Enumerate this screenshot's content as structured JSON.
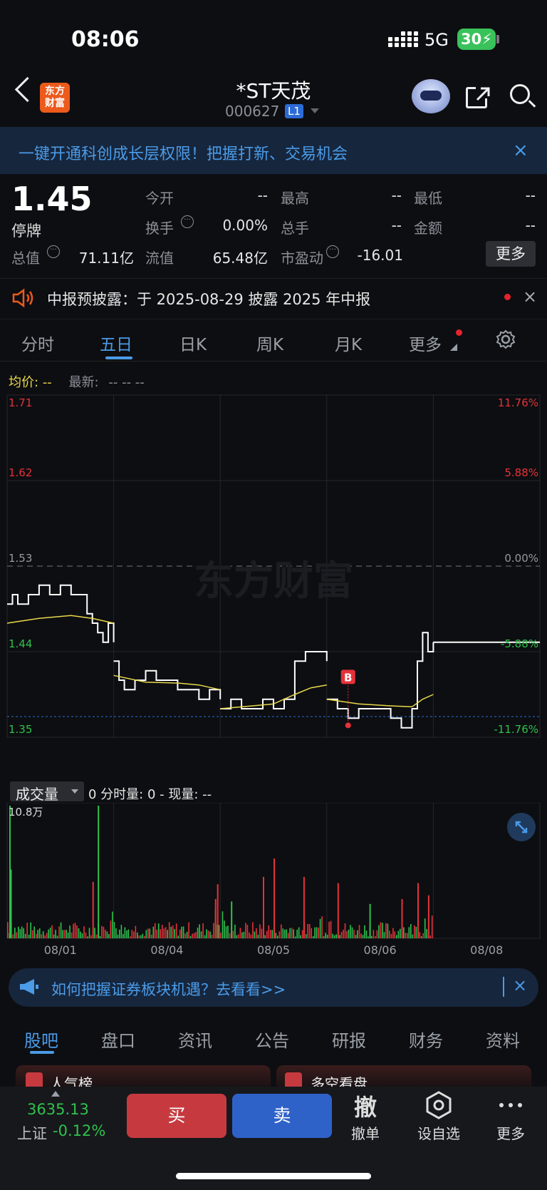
{
  "status_bar": {
    "time": "08:06",
    "network": "5G",
    "battery": "30"
  },
  "header": {
    "logo_text_1": "东方",
    "logo_text_2": "财富",
    "name": "*ST天茂",
    "code": "000627",
    "level": "L1"
  },
  "banner": {
    "text": "一键开通科创成长层权限！把握打新、交易机会",
    "close": "×"
  },
  "quote": {
    "price": "1.45",
    "status": "停牌",
    "rows": [
      [
        {
          "label": "今开",
          "value": "--"
        },
        {
          "label": "最高",
          "value": "--"
        },
        {
          "label": "最低",
          "value": "--"
        }
      ],
      [
        {
          "label": "换手",
          "value": "0.00%"
        },
        {
          "label": "总手",
          "value": "--"
        },
        {
          "label": "金额",
          "value": "--"
        }
      ],
      [
        {
          "label": "总值",
          "value": "71.11亿"
        },
        {
          "label": "流值",
          "value": "65.48亿"
        },
        {
          "label": "市盈动",
          "value": "-16.01"
        }
      ]
    ],
    "more": "更多"
  },
  "notice": {
    "text": "中报预披露：于 2025-08-29 披露 2025 年中报",
    "close": "×"
  },
  "chart_tabs": {
    "items": [
      "分时",
      "五日",
      "日K",
      "周K",
      "月K",
      "更多"
    ],
    "active_index": 1
  },
  "legend": {
    "avg_label": "均价:",
    "avg_value": "--",
    "latest_label": "最新:",
    "latest_values": "--  --  --"
  },
  "watermark": "东方财富",
  "colors": {
    "up": "#e5323a",
    "down": "#2ec24d",
    "price_line": "#ffffff",
    "avg_line": "#e8d84a",
    "accent": "#4b9be8"
  },
  "chart_data": {
    "type": "line",
    "x_labels": [
      "08/01",
      "08/04",
      "08/05",
      "08/06",
      "08/08"
    ],
    "y_ticks_left": [
      "1.71",
      "1.62",
      "1.53",
      "1.44",
      "1.35"
    ],
    "y_ticks_right": [
      "11.76%",
      "5.88%",
      "0.00%",
      "-5.88%",
      "-11.76%"
    ],
    "ylim": [
      1.35,
      1.71
    ],
    "prev_close": 1.53,
    "series": [
      {
        "name": "price",
        "days": [
          [
            [
              0,
              1.49
            ],
            [
              0.05,
              1.5
            ],
            [
              0.1,
              1.49
            ],
            [
              0.2,
              1.5
            ],
            [
              0.3,
              1.51
            ],
            [
              0.4,
              1.5
            ],
            [
              0.5,
              1.51
            ],
            [
              0.6,
              1.5
            ],
            [
              0.7,
              1.5
            ],
            [
              0.75,
              1.48
            ],
            [
              0.8,
              1.47
            ],
            [
              0.85,
              1.46
            ],
            [
              0.9,
              1.45
            ],
            [
              0.95,
              1.47
            ],
            [
              1,
              1.45
            ]
          ],
          [
            [
              0,
              1.43
            ],
            [
              0.05,
              1.41
            ],
            [
              0.1,
              1.4
            ],
            [
              0.2,
              1.41
            ],
            [
              0.3,
              1.42
            ],
            [
              0.4,
              1.41
            ],
            [
              0.5,
              1.41
            ],
            [
              0.6,
              1.4
            ],
            [
              0.7,
              1.4
            ],
            [
              0.8,
              1.39
            ],
            [
              0.9,
              1.4
            ],
            [
              1,
              1.39
            ]
          ],
          [
            [
              0,
              1.38
            ],
            [
              0.1,
              1.39
            ],
            [
              0.2,
              1.38
            ],
            [
              0.3,
              1.38
            ],
            [
              0.4,
              1.39
            ],
            [
              0.5,
              1.38
            ],
            [
              0.6,
              1.39
            ],
            [
              0.7,
              1.43
            ],
            [
              0.8,
              1.44
            ],
            [
              0.9,
              1.44
            ],
            [
              1,
              1.43
            ]
          ],
          [
            [
              0,
              1.39
            ],
            [
              0.1,
              1.38
            ],
            [
              0.2,
              1.37
            ],
            [
              0.3,
              1.38
            ],
            [
              0.4,
              1.38
            ],
            [
              0.5,
              1.38
            ],
            [
              0.6,
              1.37
            ],
            [
              0.7,
              1.36
            ],
            [
              0.8,
              1.38
            ],
            [
              0.85,
              1.43
            ],
            [
              0.9,
              1.46
            ],
            [
              0.95,
              1.44
            ],
            [
              1,
              1.45
            ]
          ],
          [
            [
              0,
              1.45
            ],
            [
              1,
              1.45
            ]
          ]
        ]
      },
      {
        "name": "average",
        "days": [
          [
            [
              0,
              1.47
            ],
            [
              0.3,
              1.475
            ],
            [
              0.6,
              1.478
            ],
            [
              0.8,
              1.475
            ],
            [
              1,
              1.47
            ]
          ],
          [
            [
              0,
              1.415
            ],
            [
              0.3,
              1.408
            ],
            [
              0.6,
              1.407
            ],
            [
              0.8,
              1.405
            ],
            [
              1,
              1.4
            ]
          ],
          [
            [
              0,
              1.38
            ],
            [
              0.3,
              1.383
            ],
            [
              0.5,
              1.385
            ],
            [
              0.7,
              1.395
            ],
            [
              0.85,
              1.402
            ],
            [
              1,
              1.405
            ]
          ],
          [
            [
              0,
              1.39
            ],
            [
              0.3,
              1.385
            ],
            [
              0.6,
              1.383
            ],
            [
              0.8,
              1.382
            ],
            [
              0.9,
              1.39
            ],
            [
              1,
              1.395
            ]
          ],
          []
        ]
      }
    ],
    "marker": {
      "label": "B",
      "day": 3,
      "t": 0.2,
      "price": 1.355
    },
    "volume": {
      "max_label": "10.8万",
      "max": 108000,
      "spikes": [
        [
          0,
          0.02,
          108000,
          "down"
        ],
        [
          0,
          0.03,
          56000,
          "down"
        ],
        [
          0,
          0.85,
          108000,
          "down"
        ],
        [
          0,
          0.8,
          46000,
          "up"
        ],
        [
          1,
          0.95,
          32000,
          "up"
        ],
        [
          1,
          0.97,
          44000,
          "up"
        ],
        [
          2,
          0.4,
          50000,
          "up"
        ],
        [
          2,
          0.5,
          65000,
          "up"
        ],
        [
          2,
          0.1,
          30000,
          "down"
        ],
        [
          2,
          0.78,
          50000,
          "up"
        ],
        [
          3,
          0.1,
          45000,
          "up"
        ],
        [
          3,
          0.4,
          28000,
          "down"
        ],
        [
          3,
          0.7,
          32000,
          "up"
        ],
        [
          3,
          0.85,
          45000,
          "up"
        ],
        [
          3,
          0.95,
          35000,
          "up"
        ]
      ]
    }
  },
  "volume_header": {
    "selector": "成交量",
    "info": "0  分时量: 0  -  现量: --"
  },
  "ad": {
    "text": "如何把握证券板块机遇？去看看>>",
    "close": "×"
  },
  "bottom_tabs": {
    "items": [
      "股吧",
      "盘口",
      "资讯",
      "公告",
      "研报",
      "财务",
      "资料"
    ],
    "active_index": 0
  },
  "peek_cards": [
    "人气榜",
    "多空看盘"
  ],
  "bottom_bar": {
    "index_value": "3635.13",
    "index_name": "上证",
    "index_change": "-0.12%",
    "buy": "买",
    "sell": "卖",
    "actions": [
      {
        "icon": "撤",
        "label": "撤单"
      },
      {
        "label": "设自选"
      },
      {
        "label": "更多"
      }
    ]
  }
}
